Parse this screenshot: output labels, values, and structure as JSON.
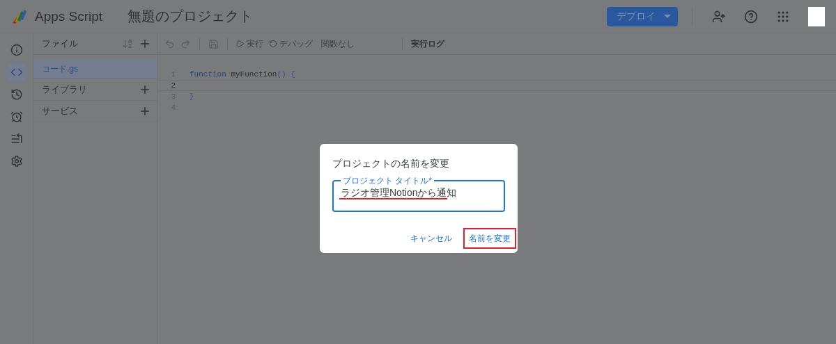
{
  "header": {
    "app_name": "Apps Script",
    "project_title": "無題のプロジェクト",
    "deploy_button": "デプロイ"
  },
  "rail": [
    {
      "kind": "info",
      "selected": false
    },
    {
      "kind": "code",
      "selected": true
    },
    {
      "kind": "history",
      "selected": false
    },
    {
      "kind": "triggers",
      "selected": false
    },
    {
      "kind": "executions",
      "selected": false
    },
    {
      "kind": "settings",
      "selected": false
    }
  ],
  "files_panel": {
    "title": "ファイル",
    "files": [
      {
        "name": "コード.gs",
        "selected": true
      }
    ],
    "sections": [
      {
        "label": "ライブラリ"
      },
      {
        "label": "サービス"
      }
    ]
  },
  "toolbar": {
    "run": "実行",
    "debug": "デバッグ",
    "function_select": "関数なし",
    "log_button": "実行ログ"
  },
  "editor": {
    "lines": [
      {
        "number": "1",
        "current": false,
        "tokens": [
          {
            "text": "function",
            "kind": "keyword"
          },
          {
            "text": " myFunction",
            "kind": "name"
          },
          {
            "text": "() {",
            "kind": "punct"
          }
        ]
      },
      {
        "number": "2",
        "current": true
      },
      {
        "number": "3",
        "current": false,
        "tokens": [
          {
            "text": "}",
            "kind": "punct"
          }
        ]
      },
      {
        "number": "4",
        "current": false
      }
    ]
  },
  "dialog": {
    "title": "プロジェクトの名前を変更",
    "field_label": "プロジェクト タイトル*",
    "field_value": "ラジオ管理Notionから通知",
    "field_underlined": true,
    "cancel": "キャンセル",
    "confirm": "名前を変更",
    "confirm_highlighted": true
  }
}
